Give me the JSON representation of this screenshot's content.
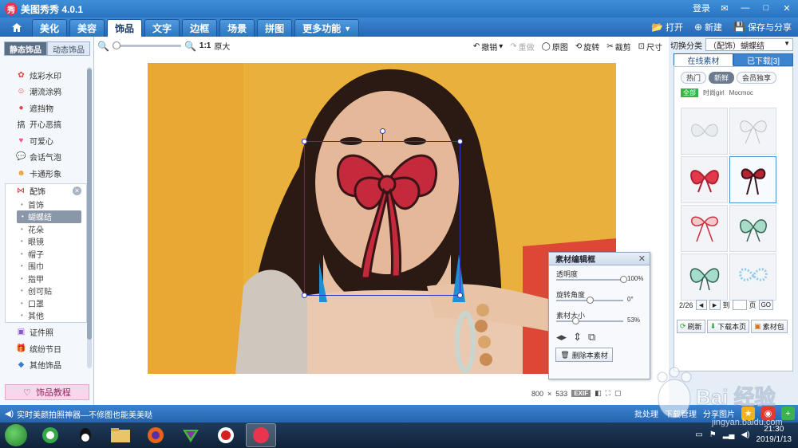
{
  "app": {
    "title": "美图秀秀 4.0.1",
    "login": "登录",
    "logo_glyph": "秀"
  },
  "toolbar": {
    "tabs": [
      {
        "label": "美化"
      },
      {
        "label": "美容"
      },
      {
        "label": "饰品"
      },
      {
        "label": "文字"
      },
      {
        "label": "边框"
      },
      {
        "label": "场景"
      },
      {
        "label": "拼图"
      },
      {
        "label": "更多功能"
      }
    ],
    "active_tab": "饰品",
    "open": "打开",
    "new": "新建",
    "save_share": "保存与分享"
  },
  "sidebar": {
    "tabs": [
      "静态饰品",
      "动态饰品"
    ],
    "items_top": [
      {
        "label": "炫彩水印"
      },
      {
        "label": "潮流涂鸦"
      },
      {
        "label": "遮挡物"
      },
      {
        "label": "开心恶搞"
      },
      {
        "label": "可爱心"
      },
      {
        "label": "会话气泡"
      },
      {
        "label": "卡通形象"
      }
    ],
    "group": {
      "label": "配饰",
      "items": [
        "首饰",
        "蝴蝶结",
        "花朵",
        "眼镜",
        "帽子",
        "围巾",
        "指甲",
        "创可贴",
        "口罩",
        "其他"
      ],
      "active": "蝴蝶结"
    },
    "items_bottom": [
      {
        "label": "证件照"
      },
      {
        "label": "缤纷节日"
      },
      {
        "label": "其他饰品"
      }
    ],
    "tutorial": "饰品教程"
  },
  "editor": {
    "zoom_ratio": "1:1",
    "original_size": "原大",
    "zoom_level": 0.05,
    "tools": [
      "撤销",
      "重做",
      "原图",
      "旋转",
      "裁剪",
      "尺寸"
    ],
    "image_width": "800",
    "image_height": "533",
    "exif": "EXIF"
  },
  "material_panel": {
    "title": "素材编辑框",
    "opacity_label": "透明度",
    "opacity_value": "100%",
    "opacity_level": 1.0,
    "rotation_label": "旋转角度",
    "rotation_value": "0°",
    "rotation_level": 0.5,
    "size_label": "素材大小",
    "size_value": "53%",
    "size_level": 0.28,
    "delete": "删除本素材"
  },
  "right_panel": {
    "category_label": "切换分类",
    "category_value": "（配饰）蝴蝶结",
    "tabs": [
      "在线素材",
      "已下载[3]"
    ],
    "chips": [
      "热门",
      "新鲜",
      "会员独享"
    ],
    "active_chip": "新鲜",
    "filters": [
      "全部",
      "时尚girl",
      "Mocmoc"
    ],
    "page_current": "2/26",
    "page_to": "到",
    "page_unit": "页",
    "go": "GO",
    "refresh": "刷新",
    "download_page": "下载本页",
    "material_pack": "素材包"
  },
  "statusbar": {
    "message": "实时美颜拍照神器—不修图也能美美哒",
    "batch": "批处理",
    "download_mgr": "下载管理",
    "share_pic": "分享图片"
  },
  "taskbar": {
    "time": "21:30",
    "date": "2019/1/13"
  },
  "watermark": {
    "text": "Bai 经验",
    "url": "jingyan.baidu.com"
  }
}
